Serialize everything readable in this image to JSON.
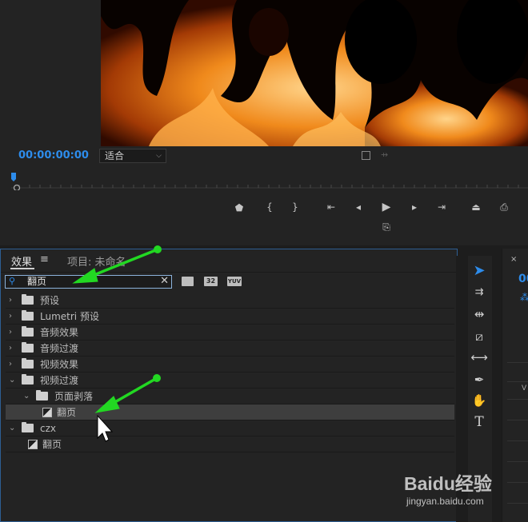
{
  "monitor": {
    "timecode": "00:00:00:00",
    "fit_label": "适合"
  },
  "effects_panel": {
    "tab_effects": "效果",
    "tab_project": "项目: 未命名",
    "search_value": "翻页",
    "preset_btns": [
      "32",
      "YUV"
    ],
    "tree": [
      {
        "label": "预设",
        "level": 0,
        "expanded": false,
        "kind": "folder-star"
      },
      {
        "label": "Lumetri 预设",
        "level": 0,
        "expanded": false,
        "kind": "folder-star"
      },
      {
        "label": "音频效果",
        "level": 0,
        "expanded": false,
        "kind": "folder"
      },
      {
        "label": "音频过渡",
        "level": 0,
        "expanded": false,
        "kind": "folder"
      },
      {
        "label": "视频效果",
        "level": 0,
        "expanded": false,
        "kind": "folder"
      },
      {
        "label": "视频过渡",
        "level": 0,
        "expanded": true,
        "kind": "folder"
      },
      {
        "label": "页面剥落",
        "level": 1,
        "expanded": true,
        "kind": "folder"
      },
      {
        "label": "翻页",
        "level": 2,
        "kind": "effect",
        "selected": true
      },
      {
        "label": "czx",
        "level": 0,
        "expanded": true,
        "kind": "folder"
      },
      {
        "label": "翻页",
        "level": 1,
        "kind": "effect"
      }
    ]
  },
  "right_panel": {
    "timecode_partial": "00",
    "clip_label": "V"
  },
  "watermark": {
    "brand": "Baidu经验",
    "url": "jingyan.baidu.com"
  },
  "colors": {
    "accent_blue": "#2d8ceb",
    "arrow_green": "#22d822",
    "panel_bg": "#232323"
  }
}
